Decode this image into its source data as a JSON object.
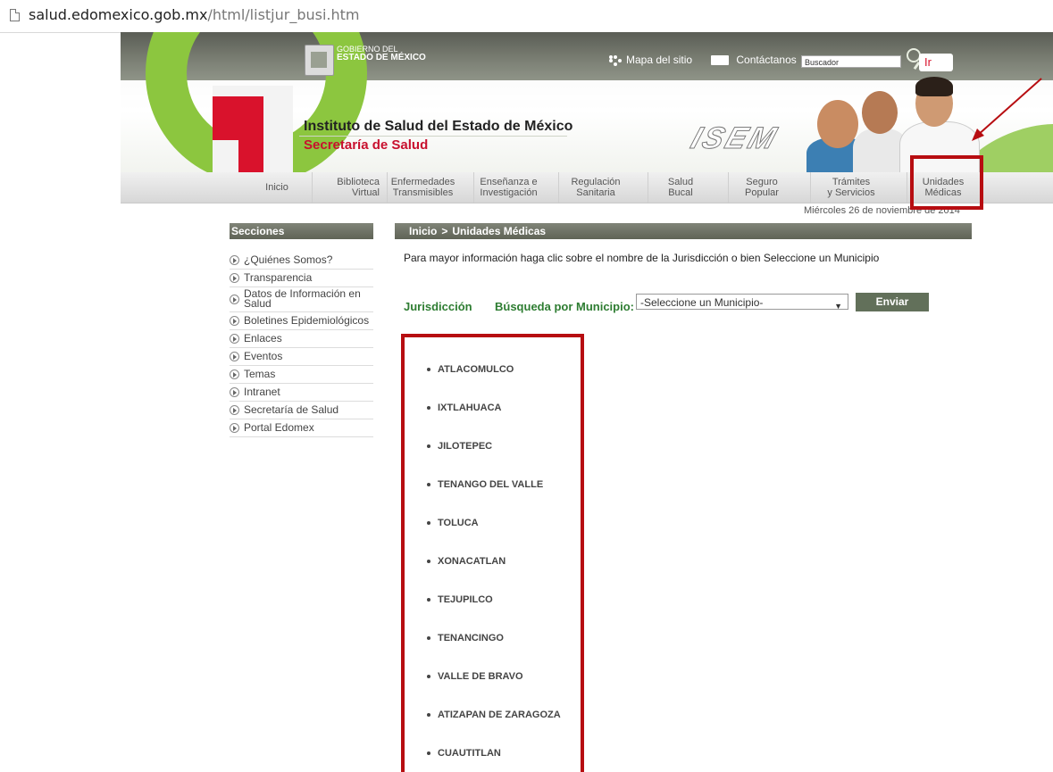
{
  "browser": {
    "url_domain": "salud.edomexico.gob.mx",
    "url_path": "/html/listjur_busi.htm"
  },
  "header": {
    "gov_line1": "GOBIERNO DEL",
    "gov_line2": "ESTADO DE MÉXICO",
    "sitemap_label": "Mapa del sitio",
    "contact_label": "Contáctanos",
    "search_placeholder": "Buscador",
    "search_button": "Ir",
    "institute_title": "Instituto de Salud del Estado de México",
    "institute_subtitle": "Secretaría de Salud",
    "isem_logo": "ISEM"
  },
  "nav": [
    {
      "label": "Inicio"
    },
    {
      "label": "Biblioteca\nVirtual"
    },
    {
      "label": "Enfermedades\nTransmisibles"
    },
    {
      "label": "Enseñanza e\nInvestigación"
    },
    {
      "label": "Regulación\nSanitaria"
    },
    {
      "label": "Salud\nBucal"
    },
    {
      "label": "Seguro\nPopular"
    },
    {
      "label": "Trámites\ny Servicios"
    },
    {
      "label": "Unidades\nMédicas"
    }
  ],
  "date": "Miércoles 26 de noviembre de 2014",
  "sidebar": {
    "title": "Secciones",
    "items": [
      "¿Quiénes Somos?",
      "Transparencia",
      "Datos de Información en Salud",
      "Boletines Epidemiológicos",
      "Enlaces",
      "Eventos",
      "Temas",
      "Intranet",
      "Secretaría de Salud",
      "Portal Edomex"
    ]
  },
  "main": {
    "breadcrumb_home": "Inicio",
    "breadcrumb_sep": ">",
    "breadcrumb_current": "Unidades Médicas",
    "info_text": "Para mayor información haga clic sobre el nombre de la Jurisdicción o bien Seleccione un Municipio",
    "jurisdiccion_label": "Jurisdicción",
    "municipio_label": "Búsqueda por Municipio:",
    "municipio_select_value": "-Seleccione un Municipio-",
    "send_button": "Enviar",
    "jurisdicciones": [
      "ATLACOMULCO",
      "IXTLAHUACA",
      "JILOTEPEC",
      "TENANGO DEL VALLE",
      "TOLUCA",
      "XONACATLAN",
      "TEJUPILCO",
      "TENANCINGO",
      "VALLE DE BRAVO",
      "ATIZAPAN DE ZARAGOZA",
      "CUAUTITLAN"
    ]
  },
  "colors": {
    "accent_green": "#8cc63f",
    "brand_red": "#d9122c",
    "annotation_red": "#b70d11",
    "heading_green": "#2e7d32"
  }
}
